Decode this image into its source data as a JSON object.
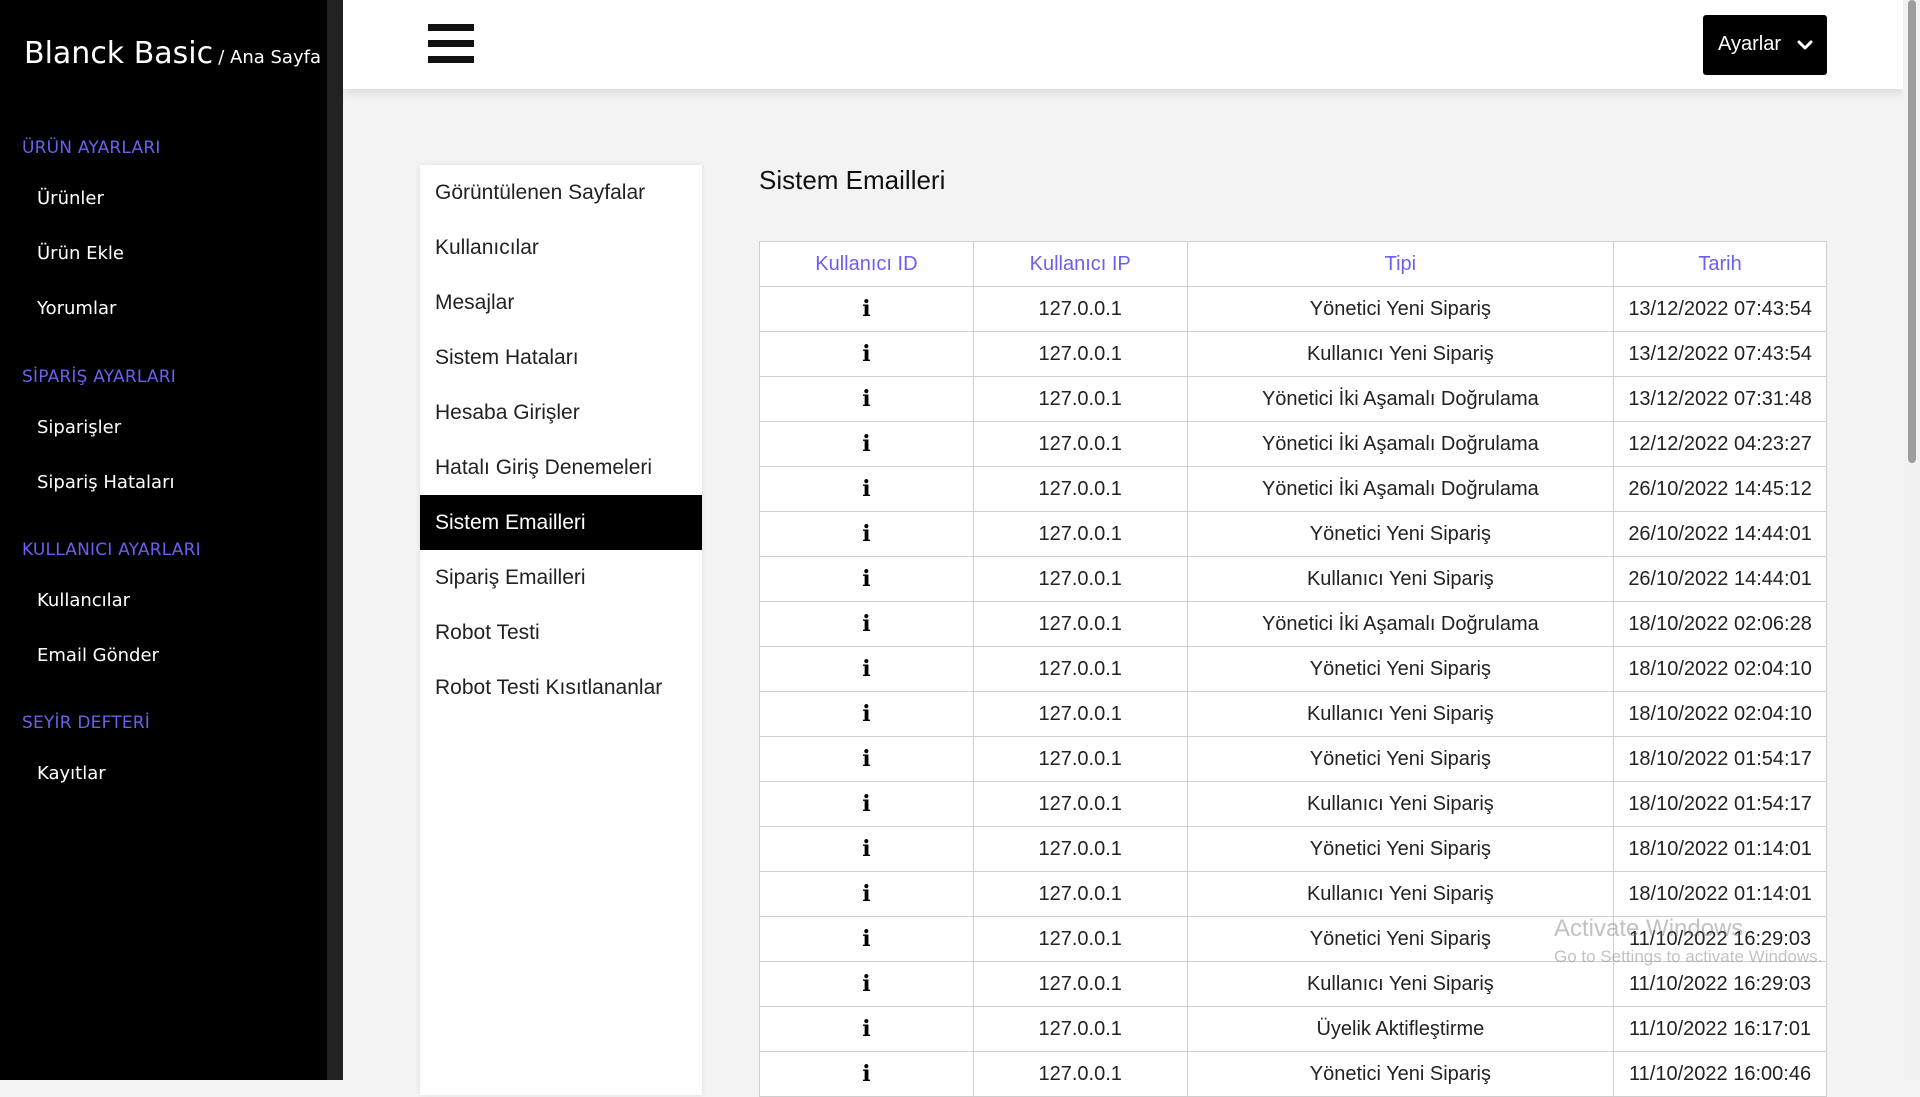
{
  "brand": {
    "title": "Blanck Basic",
    "crumb": "/ Ana Sayfa"
  },
  "sidebar": {
    "groups": [
      {
        "title": "ÜRÜN AYARLARI",
        "items": [
          "Ürünler",
          "Ürün Ekle",
          "Yorumlar"
        ]
      },
      {
        "title": "SİPARİŞ AYARLARI",
        "items": [
          "Siparişler",
          "Sipariş Hataları"
        ]
      },
      {
        "title": "KULLANICI AYARLARI",
        "items": [
          "Kullancılar",
          "Email Gönder"
        ]
      },
      {
        "title": "SEYİR DEFTERİ",
        "items": [
          "Kayıtlar"
        ]
      }
    ]
  },
  "header": {
    "settings_label": "Ayarlar",
    "menu_icon": "hamburger-icon",
    "settings_icon": "chevron-down-icon"
  },
  "subnav": {
    "items": [
      "Görüntülenen Sayfalar",
      "Kullanıcılar",
      "Mesajlar",
      "Sistem Hataları",
      "Hesaba Girişler",
      "Hatalı Giriş Denemeleri",
      "Sistem Emailleri",
      "Sipariş Emailleri",
      "Robot Testi",
      "Robot Testi Kısıtlananlar"
    ],
    "active": "Sistem Emailleri"
  },
  "main": {
    "title": "Sistem Emailleri",
    "table": {
      "headers": [
        "Kullanıcı ID",
        "Kullanıcı IP",
        "Tipi",
        "Tarih"
      ],
      "rows": [
        {
          "id": "i",
          "ip": "127.0.0.1",
          "type": "Yönetici Yeni Sipariş",
          "date": "13/12/2022 07:43:54"
        },
        {
          "id": "i",
          "ip": "127.0.0.1",
          "type": "Kullanıcı Yeni Sipariş",
          "date": "13/12/2022 07:43:54"
        },
        {
          "id": "i",
          "ip": "127.0.0.1",
          "type": "Yönetici İki Aşamalı Doğrulama",
          "date": "13/12/2022 07:31:48"
        },
        {
          "id": "i",
          "ip": "127.0.0.1",
          "type": "Yönetici İki Aşamalı Doğrulama",
          "date": "12/12/2022 04:23:27"
        },
        {
          "id": "i",
          "ip": "127.0.0.1",
          "type": "Yönetici İki Aşamalı Doğrulama",
          "date": "26/10/2022 14:45:12"
        },
        {
          "id": "i",
          "ip": "127.0.0.1",
          "type": "Yönetici Yeni Sipariş",
          "date": "26/10/2022 14:44:01"
        },
        {
          "id": "i",
          "ip": "127.0.0.1",
          "type": "Kullanıcı Yeni Sipariş",
          "date": "26/10/2022 14:44:01"
        },
        {
          "id": "i",
          "ip": "127.0.0.1",
          "type": "Yönetici İki Aşamalı Doğrulama",
          "date": "18/10/2022 02:06:28"
        },
        {
          "id": "i",
          "ip": "127.0.0.1",
          "type": "Yönetici Yeni Sipariş",
          "date": "18/10/2022 02:04:10"
        },
        {
          "id": "i",
          "ip": "127.0.0.1",
          "type": "Kullanıcı Yeni Sipariş",
          "date": "18/10/2022 02:04:10"
        },
        {
          "id": "i",
          "ip": "127.0.0.1",
          "type": "Yönetici Yeni Sipariş",
          "date": "18/10/2022 01:54:17"
        },
        {
          "id": "i",
          "ip": "127.0.0.1",
          "type": "Kullanıcı Yeni Sipariş",
          "date": "18/10/2022 01:54:17"
        },
        {
          "id": "i",
          "ip": "127.0.0.1",
          "type": "Yönetici Yeni Sipariş",
          "date": "18/10/2022 01:14:01"
        },
        {
          "id": "i",
          "ip": "127.0.0.1",
          "type": "Kullanıcı Yeni Sipariş",
          "date": "18/10/2022 01:14:01"
        },
        {
          "id": "i",
          "ip": "127.0.0.1",
          "type": "Yönetici Yeni Sipariş",
          "date": "11/10/2022 16:29:03"
        },
        {
          "id": "i",
          "ip": "127.0.0.1",
          "type": "Kullanıcı Yeni Sipariş",
          "date": "11/10/2022 16:29:03"
        },
        {
          "id": "i",
          "ip": "127.0.0.1",
          "type": "Üyelik Aktifleştirme",
          "date": "11/10/2022 16:17:01"
        },
        {
          "id": "i",
          "ip": "127.0.0.1",
          "type": "Yönetici Yeni Sipariş",
          "date": "11/10/2022 16:00:46"
        }
      ]
    }
  },
  "watermark": {
    "line1": "Activate Windows",
    "line2": "Go to Settings to activate Windows."
  },
  "colors": {
    "sidebar_bg": "#000000",
    "group_title": "#6b5ff0",
    "header_link": "#6b5ff0",
    "active_bg": "#000000"
  }
}
